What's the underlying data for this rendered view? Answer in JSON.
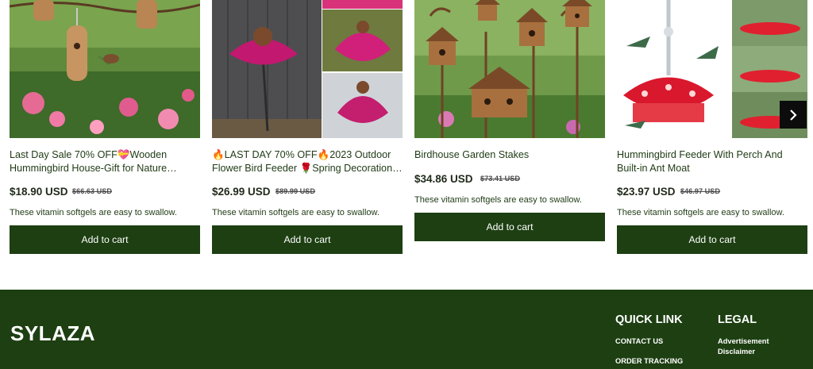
{
  "products": [
    {
      "title_lines": [
        "Last Day Sale 70% OFF💝Wooden",
        "Hummingbird House-Gift for Nature…"
      ],
      "price": "$18.90 USD",
      "compare_price": "$66.63 USD",
      "description": "These vitamin softgels are easy to swallow.",
      "button": "Add to cart"
    },
    {
      "title_lines": [
        "🔥LAST DAY 70% OFF🔥2023 Outdoor",
        "Flower Bird Feeder 🌹Spring Decoration…"
      ],
      "price": "$26.99 USD",
      "compare_price": "$89.99 USD",
      "description": "These vitamin softgels are easy to swallow.",
      "button": "Add to cart"
    },
    {
      "title_lines": [
        "Birdhouse Garden Stakes"
      ],
      "price": "$34.86 USD",
      "compare_price": "$73.41 USD",
      "description": "These vitamin softgels are easy to swallow.",
      "button": "Add to cart"
    },
    {
      "title_lines": [
        "Hummingbird Feeder With Perch And",
        "Built-in Ant Moat"
      ],
      "price": "$23.97 USD",
      "compare_price": "$46.97 USD",
      "description": "These vitamin softgels are easy to swallow.",
      "button": "Add to cart"
    }
  ],
  "carousel": {
    "next_icon": "chevron-right-icon"
  },
  "footer": {
    "brand": "SYLAZA",
    "quick_link": {
      "heading": "QUICK LINK",
      "links": [
        "CONTACT US",
        "ORDER TRACKING"
      ]
    },
    "legal": {
      "heading": "LEGAL",
      "links": [
        "Advertisement Disclaimer"
      ],
      "link_lines": [
        "Advertisement",
        "Disclaimer"
      ]
    }
  },
  "colors": {
    "primary": "#1d3f12",
    "button_text": "#ffffff",
    "text": "#1f3a14"
  }
}
